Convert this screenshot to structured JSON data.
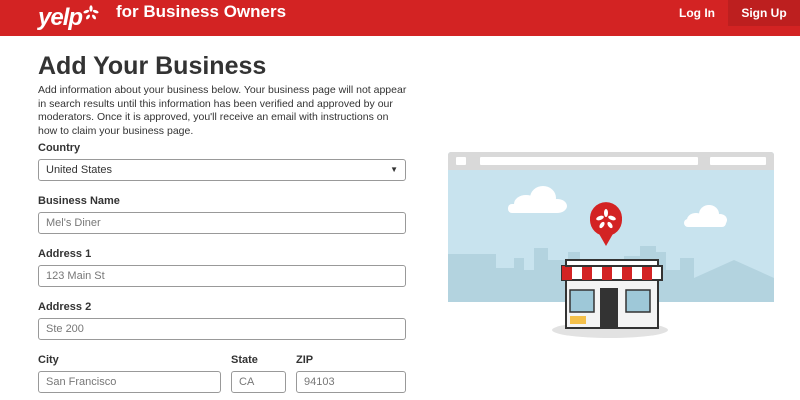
{
  "header": {
    "logo_text": "yelp",
    "product_title": "for Business Owners",
    "login_label": "Log In",
    "signup_label": "Sign Up",
    "brand_color": "#d32323"
  },
  "page": {
    "title": "Add Your Business",
    "intro": "Add information about your business below. Your business page will not appear in search results until this information has been verified and approved by our moderators. Once it is approved, you'll receive an email with instructions on how to claim your business page."
  },
  "form": {
    "country": {
      "label": "Country",
      "value": "United States"
    },
    "business_name": {
      "label": "Business Name",
      "placeholder": "Mel's Diner"
    },
    "address1": {
      "label": "Address 1",
      "placeholder": "123 Main St"
    },
    "address2": {
      "label": "Address 2",
      "placeholder": "Ste 200"
    },
    "city": {
      "label": "City",
      "placeholder": "San Francisco"
    },
    "state": {
      "label": "State",
      "placeholder": "CA"
    },
    "zip": {
      "label": "ZIP",
      "placeholder": "94103"
    }
  },
  "icons": {
    "logo": "yelp-burst-logo",
    "select_caret": "caret-down-icon",
    "illustration": "storefront-map-pin-illustration"
  }
}
